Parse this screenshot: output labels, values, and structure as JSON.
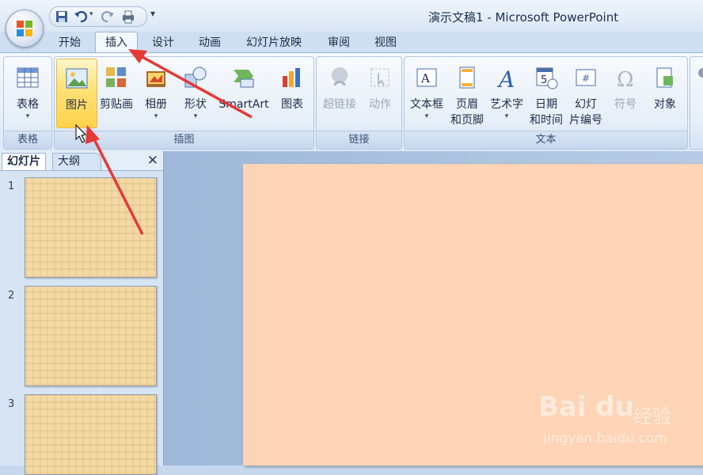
{
  "window": {
    "title": "演示文稿1 - Microsoft PowerPoint"
  },
  "quick_access": {
    "icons": [
      "save-icon",
      "undo-icon",
      "redo-icon",
      "print-icon"
    ],
    "more": "▾"
  },
  "tabs": [
    {
      "label": "开始"
    },
    {
      "label": "插入",
      "active": true
    },
    {
      "label": "设计"
    },
    {
      "label": "动画"
    },
    {
      "label": "幻灯片放映"
    },
    {
      "label": "审阅"
    },
    {
      "label": "视图"
    }
  ],
  "ribbon": {
    "groups": {
      "table": "表格",
      "illustrations": "插图",
      "links": "链接",
      "text": "文本"
    },
    "buttons": {
      "table": "表格",
      "picture": "图片",
      "clipart": "剪贴画",
      "album": "相册",
      "shapes": "形状",
      "smartart": "SmartArt",
      "chart": "图表",
      "hyperlink": "超链接",
      "action": "动作",
      "textbox": "文本框",
      "header_footer": [
        "页眉",
        "和页脚"
      ],
      "wordart": "艺术字",
      "datetime": [
        "日期",
        "和时间"
      ],
      "slide_number": [
        "幻灯",
        "片编号"
      ],
      "symbol": "符号",
      "object": "对象"
    },
    "dropdown_mark": "▾"
  },
  "left_pane": {
    "tabs": [
      "幻灯片",
      "大纲"
    ],
    "close": "✕",
    "slides": [
      {
        "number": "1"
      },
      {
        "number": "2"
      },
      {
        "number": "3"
      }
    ]
  },
  "watermark": {
    "brand": "Bai du",
    "suffix": "经验",
    "url": "jingyan.baidu.com"
  },
  "colors": {
    "slide": "#fdd4b5",
    "thumb": "#f3d9a4",
    "arrow": "#e53935",
    "highlight": "#ffd24a"
  }
}
